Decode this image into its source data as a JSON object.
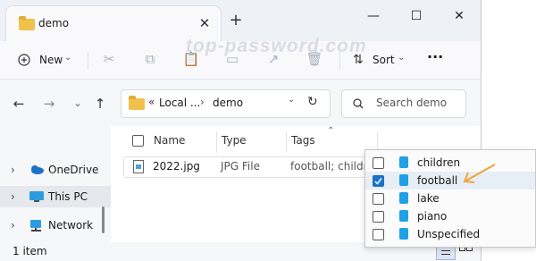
{
  "tab": {
    "title": "demo",
    "close": "✕",
    "new_tab": "+"
  },
  "window_controls": {
    "minimize": "—",
    "maximize": "☐",
    "close": "✕"
  },
  "watermark": "top-password.com",
  "toolbar": {
    "new_label": "New",
    "new_chevron": "⌄",
    "sort_label": "Sort",
    "sort_chevron": "⌄",
    "more": "···"
  },
  "address": {
    "prefix": "«",
    "crumbs": [
      "Local ...",
      "demo"
    ],
    "sep": "›",
    "chevron": "⌄",
    "refresh": "↻"
  },
  "search": {
    "placeholder": "Search demo"
  },
  "sidebar": {
    "items": [
      {
        "label": "OneDrive",
        "chevron": "›"
      },
      {
        "label": "This PC",
        "chevron": "›"
      },
      {
        "label": "Network",
        "chevron": "›"
      }
    ]
  },
  "columns": {
    "name": "Name",
    "type": "Type",
    "tags": "Tags",
    "sort_arrow": "⌃"
  },
  "files": [
    {
      "name": "2022.jpg",
      "type": "JPG File",
      "tags": "football; children"
    }
  ],
  "status": {
    "count": "1 item"
  },
  "tag_options": [
    {
      "label": "children",
      "checked": false
    },
    {
      "label": "football",
      "checked": true
    },
    {
      "label": "lake",
      "checked": false
    },
    {
      "label": "piano",
      "checked": false
    },
    {
      "label": "Unspecified",
      "checked": false
    }
  ],
  "colors": {
    "accent": "#1a73c8",
    "tag": "#1ea1e6",
    "arrow": "#f0a23c",
    "folder": "#f0c14b"
  }
}
